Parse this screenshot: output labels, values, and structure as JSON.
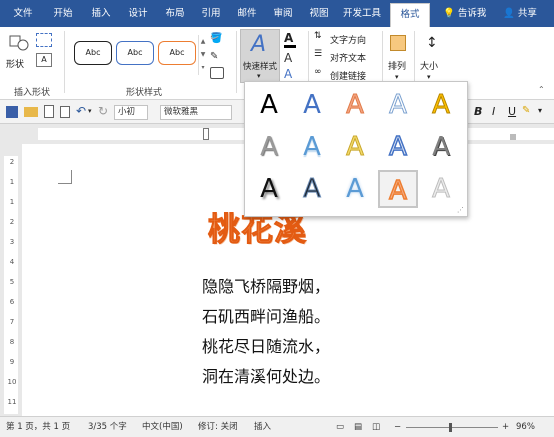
{
  "tabs": [
    "文件",
    "开始",
    "插入",
    "设计",
    "布局",
    "引用",
    "邮件",
    "审阅",
    "视图",
    "开发工具",
    "格式"
  ],
  "tell_me": "告诉我",
  "share": "共享",
  "ribbon": {
    "shape_label": "形状",
    "insert_shapes_group": "插入形状",
    "shape_styles_group": "形状样式",
    "shape_style_sample": "Abc",
    "quick_styles_label": "快速样式",
    "text_direction": "文字方向",
    "align_text": "对齐文本",
    "create_link": "创建链接",
    "arrange": "排列",
    "size": "大小"
  },
  "qat": {
    "font_size": "小初",
    "font_name": "微软雅黑"
  },
  "document": {
    "wordart_text": "桃花溪",
    "poem_lines": [
      "隐隐飞桥隔野烟，",
      "石矶西畔问渔船。",
      "桃花尽日随流水，",
      "洞在清溪何处边。"
    ]
  },
  "gallery": {
    "letter": "A",
    "rows": [
      [
        {
          "color": "#000000"
        },
        {
          "color": "#4472c4"
        },
        {
          "color": "#f4a582"
        },
        {
          "color": "#a8c4e2"
        },
        {
          "color": "#ffc000"
        }
      ],
      [
        {
          "color": "#9a9a9a"
        },
        {
          "color": "#5b9bd5"
        },
        {
          "color": "#f2da6c"
        },
        {
          "color": "#4472c4"
        },
        {
          "color": "#7f7f7f"
        }
      ],
      [
        {
          "color": "#111111"
        },
        {
          "color": "#1f2a38"
        },
        {
          "color": "#5b9bd5"
        },
        {
          "color": "#ed7d31"
        },
        {
          "color": "#d9d9d9"
        }
      ]
    ]
  },
  "status": {
    "page": "第 1 页，共 1 页",
    "words": "3/35 个字",
    "language": "中文(中国)",
    "track": "修订: 关闭",
    "insert": "插入",
    "zoom": "96%"
  },
  "colors": {
    "ribbon_blue": "#2b579a",
    "wordart_fill": "#f29a63",
    "wordart_outline": "#e35b12"
  }
}
